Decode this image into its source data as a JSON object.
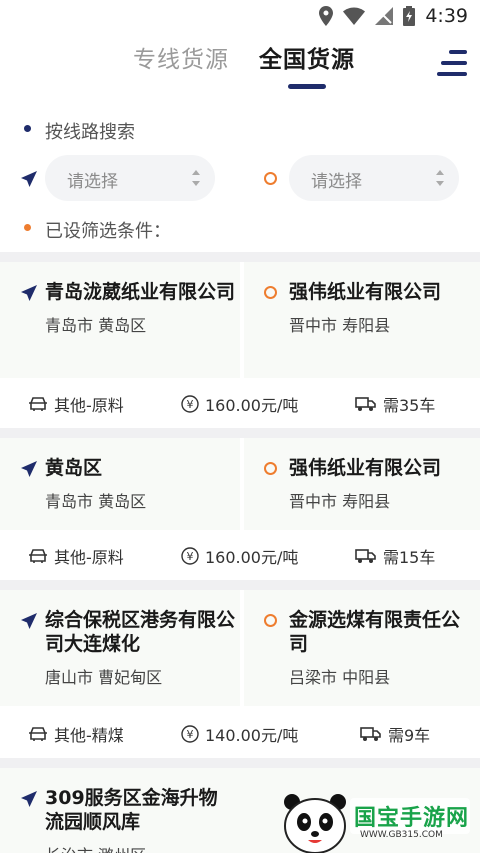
{
  "status_bar": {
    "time": "4:39"
  },
  "tabs": [
    {
      "label": "专线货源",
      "active": false
    },
    {
      "label": "全国货源",
      "active": true
    }
  ],
  "search": {
    "title": "按线路搜索",
    "from_placeholder": "请选择",
    "to_placeholder": "请选择",
    "filters_label": "已设筛选条件："
  },
  "colors": {
    "navy": "#1f2c6b",
    "orange": "#ee7d2f",
    "card_bg": "#f8faf7"
  },
  "listings": [
    {
      "from_name": "青岛泷葳纸业有限公司",
      "from_city": "青岛市 黄岛区",
      "to_name": "强伟纸业有限公司",
      "to_city": "晋中市 寿阳县",
      "category": "其他-原料",
      "price": "160.00元/吨",
      "vehicles": "需35车"
    },
    {
      "from_name": "黄岛区",
      "from_city": "青岛市 黄岛区",
      "to_name": "强伟纸业有限公司",
      "to_city": "晋中市 寿阳县",
      "category": "其他-原料",
      "price": "160.00元/吨",
      "vehicles": "需15车"
    },
    {
      "from_name": "综合保税区港务有限公司大连煤化",
      "from_city": "唐山市 曹妃甸区",
      "to_name": "金源选煤有限责任公司",
      "to_city": "吕梁市 中阳县",
      "category": "其他-精煤",
      "price": "140.00元/吨",
      "vehicles": "需9车"
    },
    {
      "from_name": "309服务区金海升物流园顺风库",
      "from_city": "长治市 潞州区"
    }
  ],
  "watermark": {
    "brand": "国宝手游网",
    "url": "WWW.GB315.COM"
  }
}
